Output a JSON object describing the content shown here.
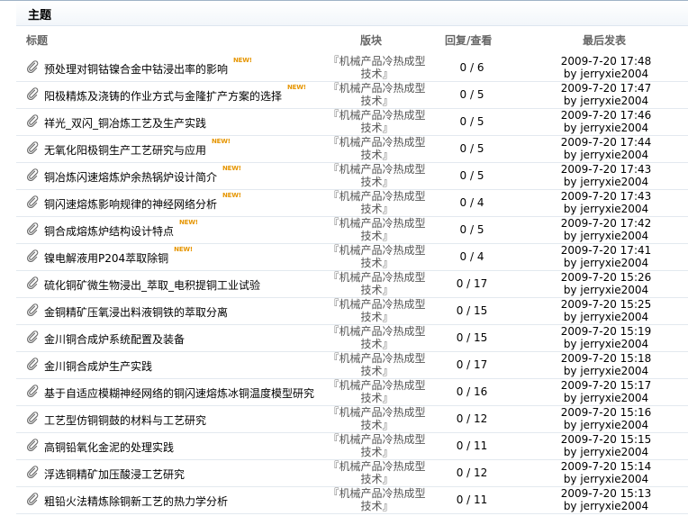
{
  "section_title": "主题",
  "columns": {
    "title": "标题",
    "board": "版块",
    "stats": "回复/查看",
    "last": "最后发表"
  },
  "new_badge": "NEW!",
  "rows": [
    {
      "subject": "预处理对铜钴镍合金中钴浸出率的影响",
      "is_new": true,
      "board": "『机械产品冷热成型技术』",
      "stats": "0 / 6",
      "last_time": "2009-7-20 17:48",
      "last_by": "by jerryxie2004"
    },
    {
      "subject": "阳极精炼及浇铸的作业方式与金隆扩产方案的选择",
      "is_new": true,
      "board": "『机械产品冷热成型技术』",
      "stats": "0 / 5",
      "last_time": "2009-7-20 17:47",
      "last_by": "by jerryxie2004"
    },
    {
      "subject": "祥光_双闪_铜冶炼工艺及生产实践",
      "is_new": false,
      "board": "『机械产品冷热成型技术』",
      "stats": "0 / 5",
      "last_time": "2009-7-20 17:46",
      "last_by": "by jerryxie2004"
    },
    {
      "subject": "无氧化阳极铜生产工艺研究与应用",
      "is_new": true,
      "board": "『机械产品冷热成型技术』",
      "stats": "0 / 5",
      "last_time": "2009-7-20 17:44",
      "last_by": "by jerryxie2004"
    },
    {
      "subject": "铜冶炼闪速熔炼炉余热锅炉设计简介",
      "is_new": true,
      "board": "『机械产品冷热成型技术』",
      "stats": "0 / 5",
      "last_time": "2009-7-20 17:43",
      "last_by": "by jerryxie2004"
    },
    {
      "subject": "铜闪速熔炼影响规律的神经网络分析",
      "is_new": true,
      "board": "『机械产品冷热成型技术』",
      "stats": "0 / 4",
      "last_time": "2009-7-20 17:43",
      "last_by": "by jerryxie2004"
    },
    {
      "subject": "铜合成熔炼炉结构设计特点",
      "is_new": true,
      "board": "『机械产品冷热成型技术』",
      "stats": "0 / 5",
      "last_time": "2009-7-20 17:42",
      "last_by": "by jerryxie2004"
    },
    {
      "subject": "镍电解液用P204萃取除铜",
      "is_new": true,
      "board": "『机械产品冷热成型技术』",
      "stats": "0 / 4",
      "last_time": "2009-7-20 17:41",
      "last_by": "by jerryxie2004"
    },
    {
      "subject": "硫化铜矿微生物浸出_萃取_电积提铜工业试验",
      "is_new": false,
      "board": "『机械产品冷热成型技术』",
      "stats": "0 / 17",
      "last_time": "2009-7-20 15:26",
      "last_by": "by jerryxie2004"
    },
    {
      "subject": "金铜精矿压氧浸出料液铜铁的萃取分离",
      "is_new": false,
      "board": "『机械产品冷热成型技术』",
      "stats": "0 / 15",
      "last_time": "2009-7-20 15:25",
      "last_by": "by jerryxie2004"
    },
    {
      "subject": "金川铜合成炉系统配置及装备",
      "is_new": false,
      "board": "『机械产品冷热成型技术』",
      "stats": "0 / 15",
      "last_time": "2009-7-20 15:19",
      "last_by": "by jerryxie2004"
    },
    {
      "subject": "金川铜合成炉生产实践",
      "is_new": false,
      "board": "『机械产品冷热成型技术』",
      "stats": "0 / 17",
      "last_time": "2009-7-20 15:18",
      "last_by": "by jerryxie2004"
    },
    {
      "subject": "基于自适应模糊神经网络的铜闪速熔炼冰铜温度模型研究",
      "is_new": false,
      "board": "『机械产品冷热成型技术』",
      "stats": "0 / 16",
      "last_time": "2009-7-20 15:17",
      "last_by": "by jerryxie2004"
    },
    {
      "subject": "工艺型仿铜铜鼓的材料与工艺研究",
      "is_new": false,
      "board": "『机械产品冷热成型技术』",
      "stats": "0 / 12",
      "last_time": "2009-7-20 15:16",
      "last_by": "by jerryxie2004"
    },
    {
      "subject": "高铜铅氧化金泥的处理实践",
      "is_new": false,
      "board": "『机械产品冷热成型技术』",
      "stats": "0 / 11",
      "last_time": "2009-7-20 15:15",
      "last_by": "by jerryxie2004"
    },
    {
      "subject": "浮选铜精矿加压酸浸工艺研究",
      "is_new": false,
      "board": "『机械产品冷热成型技术』",
      "stats": "0 / 12",
      "last_time": "2009-7-20 15:14",
      "last_by": "by jerryxie2004"
    },
    {
      "subject": "粗铅火法精炼除铜新工艺的热力学分析",
      "is_new": false,
      "board": "『机械产品冷热成型技术』",
      "stats": "0 / 11",
      "last_time": "2009-7-20 15:13",
      "last_by": "by jerryxie2004"
    }
  ]
}
